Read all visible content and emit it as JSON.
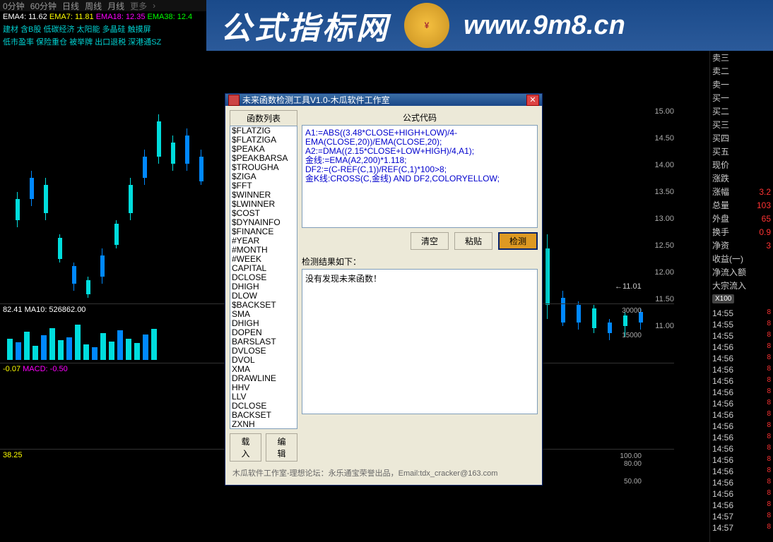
{
  "top_tabs": [
    "0分钟",
    "60分钟",
    "日线",
    "周线",
    "月线",
    "更多"
  ],
  "ema": {
    "ema4_label": "EMA4:",
    "ema4": "11.62",
    "ema7_label": "EMA7:",
    "ema7": "11.81",
    "ema18_label": "EMA18:",
    "ema18": "12.35",
    "ema38_label": "EMA38:",
    "ema38": "12.4"
  },
  "sectors_row1": "建材   含B股 低碳经济 太阳能 多晶硅 触摸屏",
  "sectors_row2": "低市盈率 保险重仓 被举牌 出口退税 深港通SZ",
  "banner": {
    "title": "公式指标网",
    "url": "www.9m8.cn"
  },
  "yaxis_main": [
    "15.00",
    "14.50",
    "14.00",
    "13.50",
    "13.00",
    "12.50",
    "12.00",
    "11.50",
    "11.00"
  ],
  "data_label_11": "←11.01",
  "sub1": {
    "label": "82.41 MA10: 526862.00",
    "yaxis": [
      "30000",
      "15000"
    ]
  },
  "sub2": {
    "prefix": "-0.07",
    "macd_label": "MACD:",
    "macd_val": "-0.50"
  },
  "sub3": {
    "label": "38.25",
    "yaxis": [
      "100.00",
      "80.00",
      "50.00"
    ]
  },
  "quote": {
    "rows": [
      {
        "label": "卖三",
        "val": ""
      },
      {
        "label": "卖二",
        "val": ""
      },
      {
        "label": "卖一",
        "val": ""
      },
      {
        "label": "买一",
        "val": ""
      },
      {
        "label": "买二",
        "val": ""
      },
      {
        "label": "买三",
        "val": ""
      },
      {
        "label": "买四",
        "val": ""
      },
      {
        "label": "买五",
        "val": ""
      },
      {
        "label": "现价",
        "val": ""
      },
      {
        "label": "涨跌",
        "val": ""
      },
      {
        "label": "涨幅",
        "val": "3.2"
      },
      {
        "label": "总量",
        "val": "103"
      },
      {
        "label": "外盘",
        "val": "65"
      },
      {
        "label": "换手",
        "val": "0.9"
      },
      {
        "label": "净资",
        "val": "3"
      },
      {
        "label": "收益(一)",
        "val": ""
      },
      {
        "label": "净流入额",
        "val": ""
      },
      {
        "label": "大宗流入",
        "val": ""
      }
    ],
    "x100": "X100",
    "times": [
      "14:55",
      "14:55",
      "14:55",
      "14:56",
      "14:56",
      "14:56",
      "14:56",
      "14:56",
      "14:56",
      "14:56",
      "14:56",
      "14:56",
      "14:56",
      "14:56",
      "14:56",
      "14:56",
      "14:56",
      "14:56",
      "14:57",
      "14:57"
    ]
  },
  "dialog": {
    "title": "未来函数检测工具V1.0-木瓜软件工作室",
    "left_header": "函数列表",
    "right_header": "公式代码",
    "functions": [
      "$FLATZIG",
      "$FLATZIGA",
      "$PEAKA",
      "$PEAKBARSA",
      "$TROUGHA",
      "$ZIGA",
      "$FFT",
      "$WINNER",
      "$LWINNER",
      "$COST",
      "$DYNAINFO",
      "$FINANCE",
      "#YEAR",
      "#MONTH",
      "#WEEK",
      "CAPITAL",
      "DCLOSE",
      "DHIGH",
      "DLOW",
      "$BACKSET",
      "SMA",
      "DHIGH",
      "DOPEN",
      "BARSLAST",
      "DVLOSE",
      "DVOL",
      "XMA",
      "DRAWLINE",
      "HHV",
      "LLV",
      "DCLOSE",
      "BACKSET",
      "ZXNH"
    ],
    "code_lines": [
      "A1:=ABS((3.48*CLOSE+HIGH+LOW)/4-EMA(CLOSE,20))/EMA(CLOSE,20);",
      "A2:=DMA((2.15*CLOSE+LOW+HIGH)/4,A1);",
      "金线:=EMA(A2,200)*1.118;",
      "DF2:=(C-REF(C,1))/REF(C,1)*100>8;",
      "金K线:CROSS(C,金线) AND DF2,COLORYELLOW;"
    ],
    "btn_clear": "清空",
    "btn_paste": "粘贴",
    "btn_detect": "检测",
    "result_label": "检测结果如下：",
    "result_text": "没有发现未来函数！",
    "btn_load": "载入",
    "btn_edit": "编辑",
    "footer": "木瓜软件工作室-理想论坛：永乐通宝荣誉出品，Email:tdx_cracker@163.com"
  }
}
